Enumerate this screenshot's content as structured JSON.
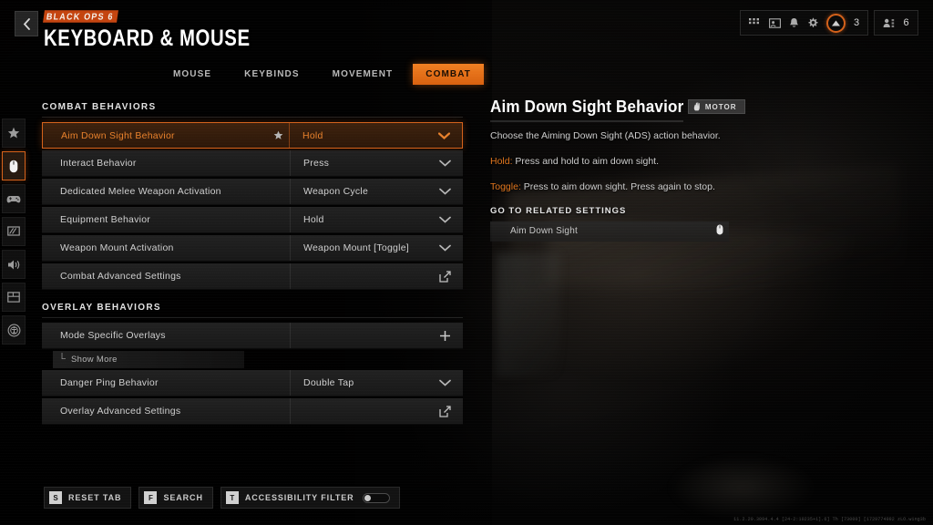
{
  "header": {
    "franchise_logo": "BLACK OPS 6",
    "page_title": "KEYBOARD & MOUSE",
    "back_icon": "chevron-left-icon"
  },
  "status_bar": {
    "icons": [
      "apps-grid-icon",
      "card-icon",
      "bell-icon",
      "gear-icon"
    ],
    "prestige_icon": "prestige-triangle-icon",
    "prestige_count": "3",
    "social_icon": "friends-icon",
    "social_count": "6"
  },
  "rail": {
    "items": [
      {
        "icon": "star-icon",
        "name": "favorites"
      },
      {
        "icon": "mouse-icon",
        "name": "keyboard-mouse",
        "active": true
      },
      {
        "icon": "gamepad-icon",
        "name": "controller"
      },
      {
        "icon": "display-icon",
        "name": "graphics"
      },
      {
        "icon": "speaker-icon",
        "name": "audio"
      },
      {
        "icon": "interface-icon",
        "name": "interface"
      },
      {
        "icon": "accessibility-icon",
        "name": "accessibility"
      }
    ]
  },
  "tabs": [
    {
      "label": "MOUSE",
      "active": false
    },
    {
      "label": "KEYBINDS",
      "active": false
    },
    {
      "label": "MOVEMENT",
      "active": false
    },
    {
      "label": "COMBAT",
      "active": true
    }
  ],
  "sections": [
    {
      "title": "COMBAT BEHAVIORS",
      "rows": [
        {
          "label": "Aim Down Sight Behavior",
          "value": "Hold",
          "control": "chevron-down-icon",
          "selected": true,
          "starred": true
        },
        {
          "label": "Interact Behavior",
          "value": "Press",
          "control": "chevron-down-icon"
        },
        {
          "label": "Dedicated Melee Weapon Activation",
          "value": "Weapon Cycle",
          "control": "chevron-down-icon"
        },
        {
          "label": "Equipment Behavior",
          "value": "Hold",
          "control": "chevron-down-icon"
        },
        {
          "label": "Weapon Mount Activation",
          "value": "Weapon Mount [Toggle]",
          "control": "chevron-down-icon"
        },
        {
          "label": "Combat Advanced Settings",
          "value": "",
          "control": "external-link-icon"
        }
      ]
    },
    {
      "title": "OVERLAY BEHAVIORS",
      "rows": [
        {
          "label": "Mode Specific Overlays",
          "value": "",
          "control": "plus-icon"
        },
        {
          "label": "Show More",
          "type": "submore",
          "branch": "└"
        },
        {
          "label": "Danger Ping Behavior",
          "value": "Double Tap",
          "control": "chevron-down-icon"
        },
        {
          "label": "Overlay Advanced Settings",
          "value": "",
          "control": "external-link-icon"
        }
      ]
    }
  ],
  "info_panel": {
    "title": "Aim Down Sight Behavior",
    "badge": {
      "icon": "motor-accessibility-icon",
      "label": "MOTOR"
    },
    "description": "Choose the Aiming Down Sight (ADS) action behavior.",
    "hold_keyword": "Hold:",
    "hold_text": " Press and hold to aim down sight.",
    "toggle_keyword": "Toggle:",
    "toggle_text": " Press to aim down sight. Press again to stop.",
    "related_heading": "GO TO RELATED SETTINGS",
    "related_items": [
      {
        "label": "Aim Down Sight",
        "icon": "mouse-icon"
      }
    ]
  },
  "bottom_bar": {
    "buttons": [
      {
        "key": "S",
        "label": "RESET TAB"
      },
      {
        "key": "F",
        "label": "SEARCH"
      },
      {
        "key": "T",
        "label": "ACCESSIBILITY FILTER",
        "toggle": true,
        "toggle_on": false
      }
    ]
  },
  "build_info": "11.2.20.3094.4.4 [24-2:10235+1].6] Th [73000] [1729774992 zLO.wing3b",
  "colors": {
    "accent": "#d4611a",
    "accent_bright": "#f07f22",
    "panel": "#242424",
    "text": "#cfcfcf"
  }
}
